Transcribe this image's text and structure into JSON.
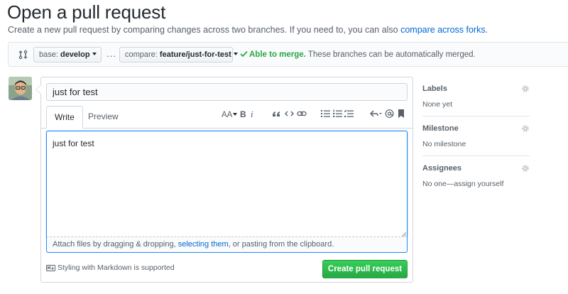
{
  "page": {
    "title": "Open a pull request",
    "subtitle_text": "Create a new pull request by comparing changes across two branches. If you need to, you can also ",
    "subtitle_link": "compare across forks",
    "subtitle_end": "."
  },
  "compare": {
    "base_prefix": "base: ",
    "base_branch": "develop",
    "dots": "...",
    "compare_prefix": "compare: ",
    "compare_branch": "feature/just-for-test",
    "merge_ok": "Able to merge.",
    "merge_text": " These branches can be automatically merged.",
    "icons": [
      "git-compare-icon",
      "check-icon"
    ]
  },
  "form": {
    "title_value": "just for test",
    "tabs": [
      {
        "label": "Write",
        "selected": true
      },
      {
        "label": "Preview",
        "selected": false
      }
    ],
    "toolbar": {
      "header_label": "AA",
      "bold_label": "B",
      "italic_label": "i"
    },
    "body_value": "just for test",
    "attach_prefix": "Attach files by dragging & dropping, ",
    "attach_link": "selecting them",
    "attach_suffix": ", or pasting from the clipboard.",
    "markdown_note": "Styling with Markdown is supported",
    "submit_label": "Create pull request"
  },
  "sidebar": {
    "labels": {
      "heading": "Labels",
      "value": "None yet"
    },
    "milestone": {
      "heading": "Milestone",
      "value": "No milestone"
    },
    "assignees": {
      "heading": "Assignees",
      "value": "No one—assign yourself"
    }
  },
  "colors": {
    "accent": "#0366d6",
    "success": "#28a745",
    "button_green": "#2cbe4e"
  }
}
